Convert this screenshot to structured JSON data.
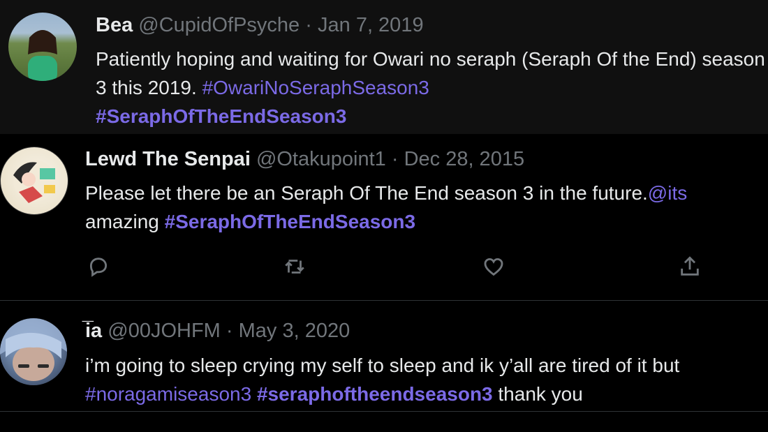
{
  "tweets": [
    {
      "name": "Bea",
      "handle": "@CupidOfPsyche",
      "separator": "·",
      "date": "Jan 7, 2019",
      "text_1": "Patiently hoping and waiting for Owari no seraph (Seraph Of the End) season 3 this 2019.",
      "hashtag_1": "#OwariNoSeraphSeason3",
      "hashtag_2": "#SeraphOfTheEndSeason3"
    },
    {
      "name": "Lewd The Senpai",
      "handle": "@Otakupoint1",
      "separator": "·",
      "date": "Dec 28, 2015",
      "text_1": "Please let there be an Seraph Of The End season 3 in the future.",
      "mention": "@its",
      "text_2": "amazing",
      "hashtag_1": "#SeraphOfTheEndSeason3"
    },
    {
      "name": "i̅a",
      "handle": "@00JOHFM",
      "separator": "·",
      "date": "May 3, 2020",
      "text_1": "i’m going to sleep crying my self to sleep and ik y’all are tired of it but",
      "hashtag_1": "#noragamiseason3",
      "hashtag_2": "#seraphoftheendseason3",
      "text_2": "thank you"
    }
  ],
  "actions": {
    "icons": [
      "reply-icon",
      "retweet-icon",
      "like-icon",
      "share-icon"
    ]
  },
  "colors": {
    "background": "#000000",
    "highlight_background": "#101010",
    "hashtag": "#7b6ae6",
    "secondary_text": "#71767b",
    "primary_text": "#e7e9ea"
  }
}
